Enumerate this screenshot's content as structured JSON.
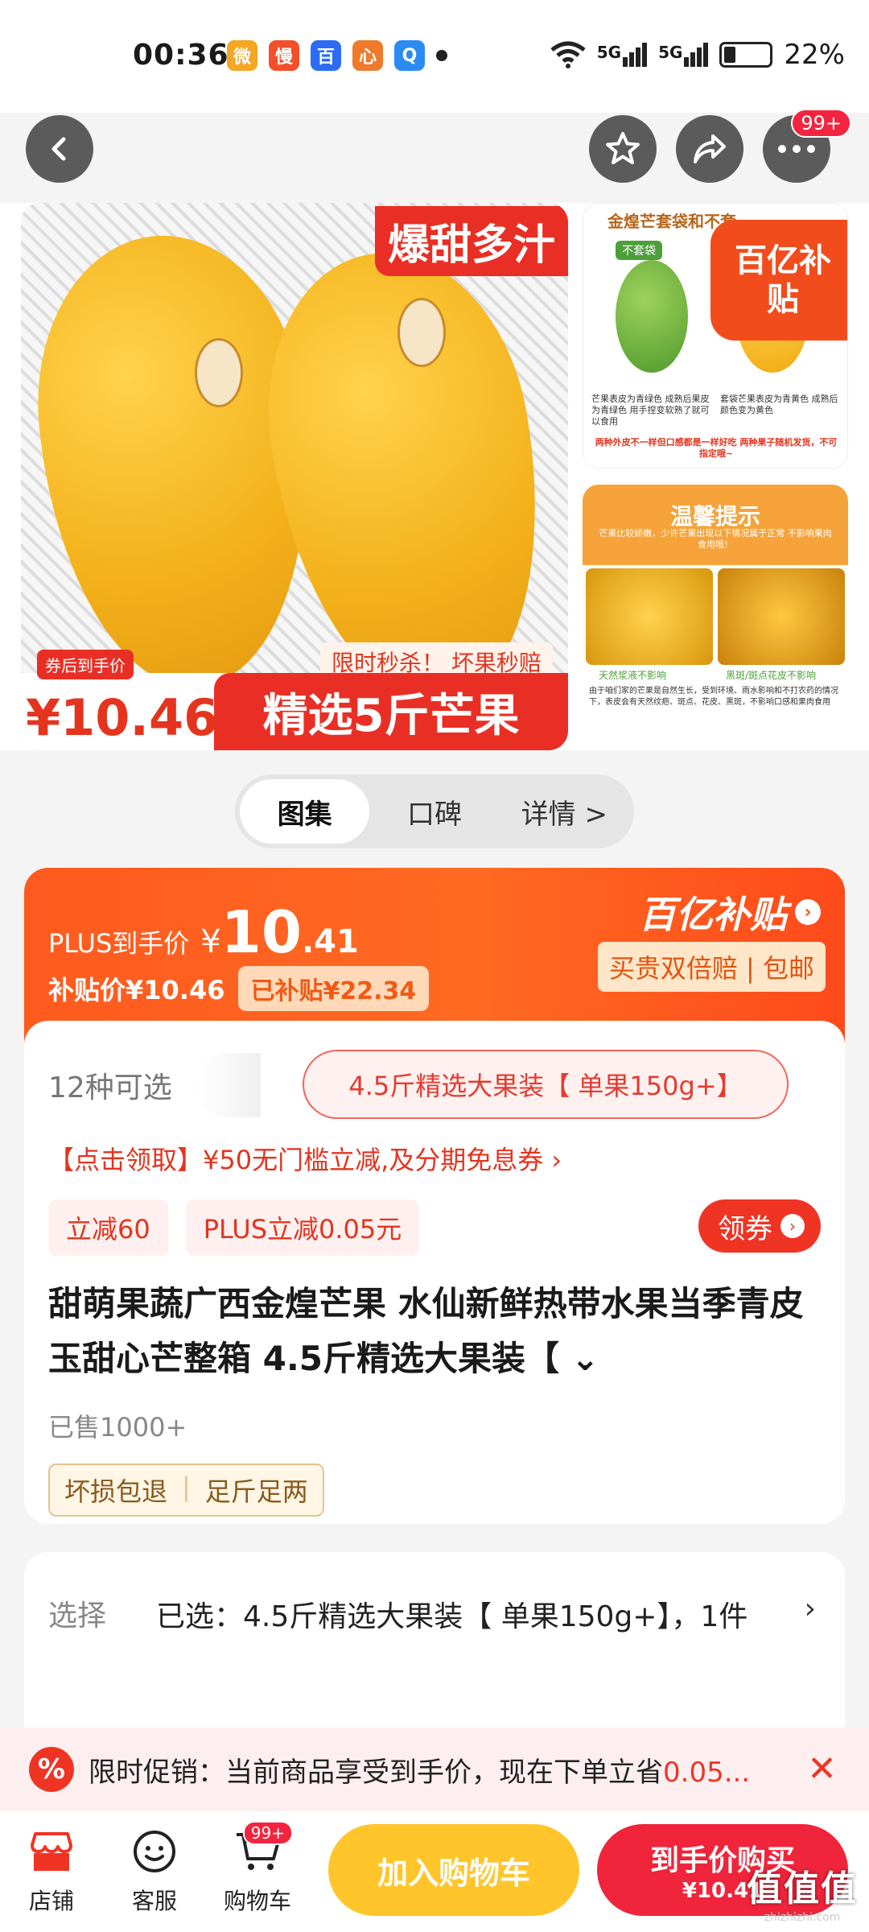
{
  "status_bar": {
    "time": "00:36",
    "battery": "22%",
    "network1": "5G",
    "network2": "5G",
    "app_icons": [
      {
        "name": "weibo-icon",
        "glyph": "微",
        "color": "#f5a623"
      },
      {
        "name": "app-icon",
        "glyph": "慢",
        "color": "#f2502a"
      },
      {
        "name": "baidu-icon",
        "glyph": "百",
        "color": "#2b6cf2"
      },
      {
        "name": "app2-icon",
        "glyph": "心",
        "color": "#f07a2b"
      },
      {
        "name": "search-app-icon",
        "glyph": "Q",
        "color": "#2a8cf2"
      }
    ]
  },
  "nav": {
    "cart_badge": "99+"
  },
  "gallery": {
    "main_badge": "爆甜多汁",
    "flash_text": "限时秒杀！ 坏果秒赔",
    "after_coupon_label": "券后到手价",
    "after_coupon_price": "¥10.46",
    "banner_text": "精选5斤芒果",
    "side1_title": "金煌芒套袋和不套",
    "side1_tag": "不套袋",
    "side1_left_caption": "芒果表皮为青绿色 成熟后果皮为青绿色 用手捏变软熟了就可以食用",
    "side1_right_caption": "套袋芒果表皮为青黄色 成熟后颜色变为黄色",
    "side1_note": "两种外皮不一样但口感都是一样好吃 两种果子随机发货，不可指定哦~",
    "yi_subsidy": "百亿补贴",
    "side2_title": "温馨提示",
    "side2_sub": "芒果比较娇嫩，少许芒果出现以下情况属于正常 不影响果肉食用哦！",
    "side2_cap1": "天然浆液不影响",
    "side2_cap2": "黑斑/斑点花皮不影响",
    "side2_body": "由于咱们家的芒果是自然生长，受到环境、雨水影响和不打农药的情况下，表皮会有天然纹疤、斑点、花皮、黑斑，不影响口感和果肉食用"
  },
  "tabs": [
    {
      "label": "图集",
      "active": true
    },
    {
      "label": "口碑",
      "active": false
    },
    {
      "label": "详情 >",
      "active": false
    }
  ],
  "price": {
    "plus_label": "PLUS到手价",
    "plus_yen": "¥",
    "plus_int": "10",
    "plus_dec": ".41",
    "subsidy_label": "补贴价¥10.46",
    "subsidized": "已补贴¥22.34",
    "yi_logo": "百亿补贴",
    "yi_tag": "买贵双倍赔 | 包邮"
  },
  "product": {
    "variants_count": "12种可选",
    "selected_variant": "4.5斤精选大果装【 单果150g+】",
    "coupon_line": "【点击领取】¥50无门槛立减,及分期免息券 ›",
    "tags": [
      "立减60",
      "PLUS立减0.05元"
    ],
    "coupon_button": "领券",
    "title": "甜萌果蔬广西金煌芒果 水仙新鲜热带水果当季青皮玉甜心芒整箱 4.5斤精选大果装【 ⌄",
    "sold": "已售1000+",
    "promise1": "坏损包退",
    "promise2": "足斤足两"
  },
  "selection": {
    "label": "选择",
    "text": "已选：4.5斤精选大果装【 单果150g+】，1件",
    "arrow": "›"
  },
  "promo": {
    "icon": "%",
    "text": "限时促销：当前商品享受到手价，现在下单立省",
    "highlight": "0.05...",
    "close": "✕"
  },
  "bottom": {
    "store": "店铺",
    "service": "客服",
    "cart": "购物车",
    "cart_badge": "99+",
    "add_cart": "加入购物车",
    "buy_label": "到手价购买",
    "buy_price": "¥10.41",
    "watermark": "值值值",
    "watermark_url": "zhizhizhi.com"
  },
  "colors": {
    "accent_red": "#f03424",
    "accent_orange": "#ff5a1f",
    "cart_yellow": "#ffc52a",
    "mango_yellow": "#f4b21b"
  }
}
